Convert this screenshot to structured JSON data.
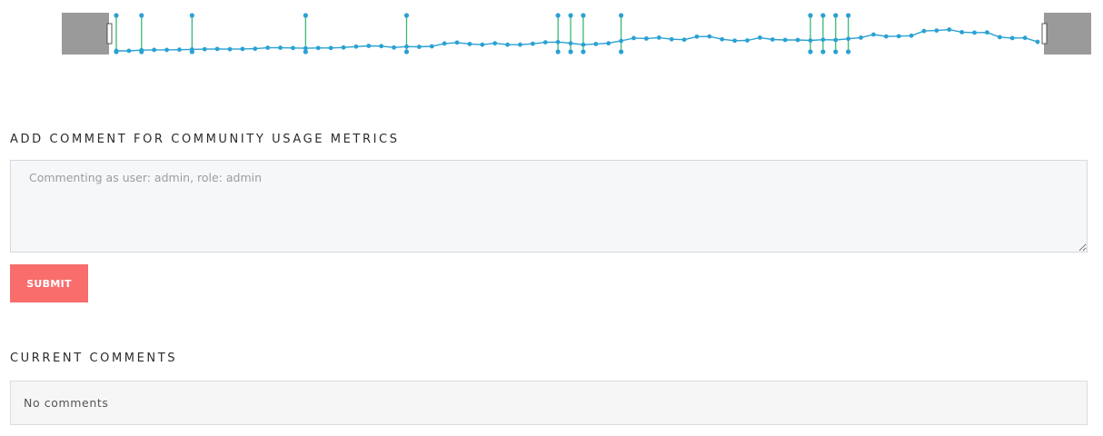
{
  "timeline": {
    "line_color": "#2aa1d3",
    "marker_color": "#3ab879",
    "handle_color": "#9a9a9a",
    "chart_data": {
      "type": "line",
      "title": "",
      "xlabel": "",
      "ylabel": "",
      "values": [
        0.96,
        0.96,
        0.93,
        0.92,
        0.92,
        0.91,
        0.9,
        0.89,
        0.88,
        0.89,
        0.88,
        0.87,
        0.83,
        0.83,
        0.84,
        0.85,
        0.84,
        0.84,
        0.82,
        0.78,
        0.75,
        0.76,
        0.82,
        0.78,
        0.79,
        0.77,
        0.65,
        0.61,
        0.67,
        0.7,
        0.64,
        0.7,
        0.7,
        0.66,
        0.6,
        0.59,
        0.64,
        0.7,
        0.67,
        0.64,
        0.54,
        0.42,
        0.44,
        0.4,
        0.47,
        0.49,
        0.36,
        0.35,
        0.47,
        0.53,
        0.52,
        0.4,
        0.48,
        0.5,
        0.5,
        0.52,
        0.49,
        0.5,
        0.45,
        0.4,
        0.27,
        0.35,
        0.34,
        0.32,
        0.12,
        0.1,
        0.06,
        0.17,
        0.19,
        0.18,
        0.38,
        0.42,
        0.41,
        0.58
      ],
      "event_markers": [
        0,
        2,
        6,
        15,
        23,
        35,
        36,
        37,
        40,
        55,
        56,
        57,
        58
      ]
    }
  },
  "comment_form": {
    "heading": "ADD COMMENT FOR COMMUNITY USAGE METRICS",
    "placeholder": "Commenting as user: admin, role: admin",
    "value": "",
    "submit_label": "SUBMIT",
    "submit_color": "#f96d6d"
  },
  "comments": {
    "heading": "CURRENT COMMENTS",
    "empty_text": "No comments"
  }
}
